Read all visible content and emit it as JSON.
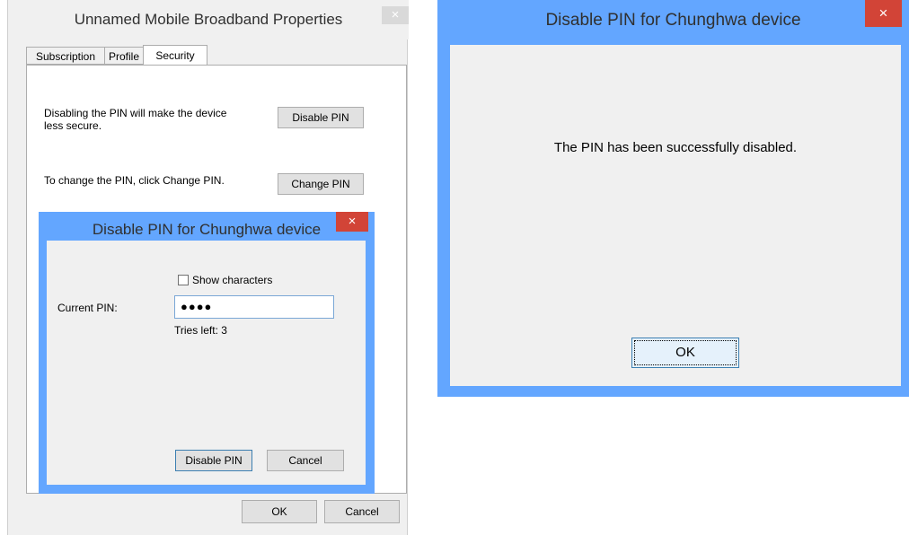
{
  "properties_window": {
    "title": "Unnamed Mobile Broadband Properties",
    "close_label": "×",
    "tabs": [
      {
        "label": "Subscription"
      },
      {
        "label": "Profile"
      },
      {
        "label": "Security",
        "active": true
      }
    ],
    "security": {
      "disable_text_line1": "Disabling the PIN will make the device",
      "disable_text_line2": "less secure.",
      "disable_button": "Disable PIN",
      "change_text": "To change the PIN, click Change PIN.",
      "change_button": "Change PIN"
    },
    "ok_button": "OK",
    "cancel_button": "Cancel"
  },
  "pin_dialog": {
    "title": "Disable PIN for Chunghwa device",
    "close_label": "×",
    "show_characters_label": "Show characters",
    "show_characters_checked": false,
    "current_pin_label": "Current PIN:",
    "current_pin_value": "●●●●",
    "tries_left": "Tries left: 3",
    "disable_button": "Disable PIN",
    "cancel_button": "Cancel"
  },
  "confirm_dialog": {
    "title": "Disable PIN for Chunghwa device",
    "close_label": "×",
    "message": "The PIN has been successfully disabled.",
    "ok_button": "OK"
  },
  "colors": {
    "active_frame": "#63a6ff",
    "close_red": "#d24437",
    "dialog_bg": "#f0f0f0"
  }
}
